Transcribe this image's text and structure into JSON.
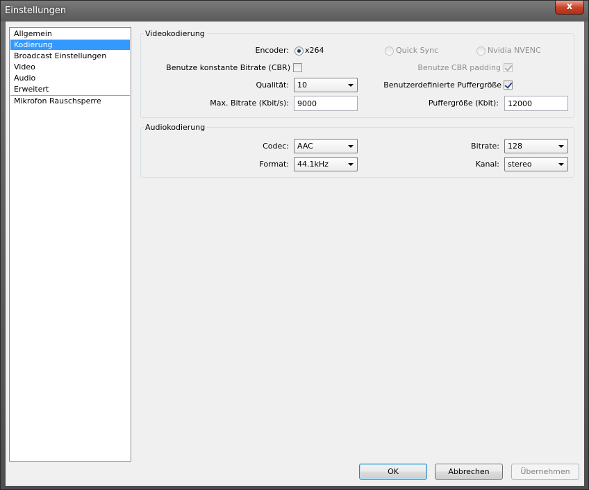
{
  "window": {
    "title": "Einstellungen",
    "close_label": "x"
  },
  "nav": {
    "items": [
      {
        "label": "Allgemein",
        "selected": false
      },
      {
        "label": "Kodierung",
        "selected": true
      },
      {
        "label": "Broadcast Einstellungen",
        "selected": false
      },
      {
        "label": "Video",
        "selected": false
      },
      {
        "label": "Audio",
        "selected": false
      },
      {
        "label": "Erweitert",
        "selected": false
      },
      {
        "label": "Mikrofon Rauschsperre",
        "selected": false
      }
    ]
  },
  "video": {
    "group_label": "Videokodierung",
    "encoder_label": "Encoder:",
    "encoders": [
      {
        "label": "x264",
        "checked": true,
        "enabled": true
      },
      {
        "label": "Quick Sync",
        "checked": false,
        "enabled": false
      },
      {
        "label": "Nvidia NVENC",
        "checked": false,
        "enabled": false
      }
    ],
    "cbr_label": "Benutze konstante Bitrate (CBR)",
    "cbr_checked": false,
    "cbr_padding_label": "Benutze CBR padding",
    "cbr_padding_checked": true,
    "quality_label": "Qualität:",
    "quality_value": "10",
    "custom_buffer_label": "Benutzerdefinierte Puffergröße",
    "custom_buffer_checked": true,
    "max_bitrate_label": "Max. Bitrate (Kbit/s):",
    "max_bitrate_value": "9000",
    "buffer_size_label": "Puffergröße (Kbit):",
    "buffer_size_value": "12000"
  },
  "audio": {
    "group_label": "Audiokodierung",
    "codec_label": "Codec:",
    "codec_value": "AAC",
    "bitrate_label": "Bitrate:",
    "bitrate_value": "128",
    "format_label": "Format:",
    "format_value": "44.1kHz",
    "channel_label": "Kanal:",
    "channel_value": "stereo"
  },
  "buttons": {
    "ok": "OK",
    "cancel": "Abbrechen",
    "apply": "Übernehmen"
  }
}
